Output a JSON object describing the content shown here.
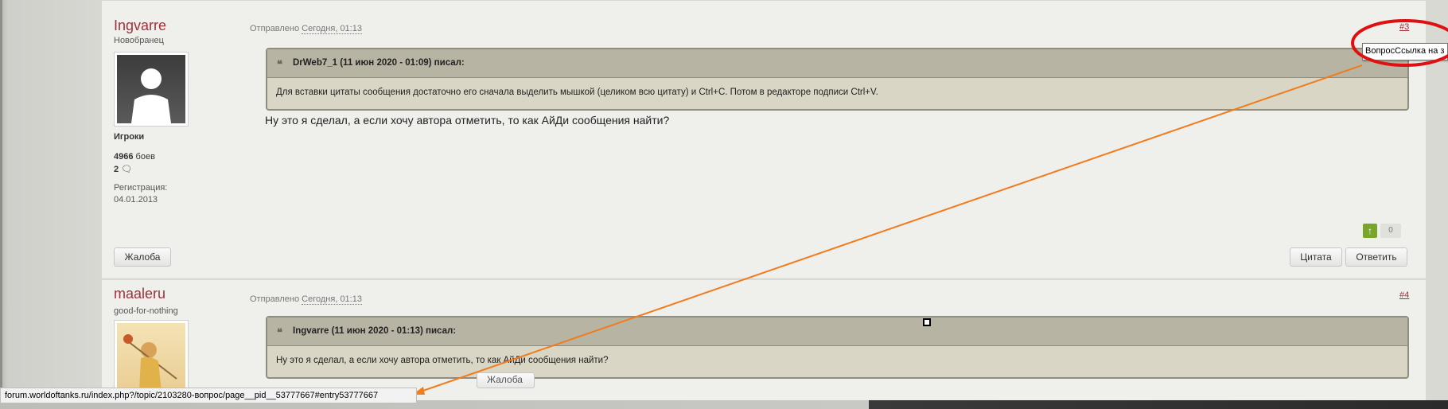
{
  "post1": {
    "author": "Ingvarre",
    "rank": "Новобранец",
    "group": "Игроки",
    "battles_count": "4966",
    "battles_label": "боев",
    "posts_count": "2",
    "reg_label": "Регистрация:",
    "reg_date": "04.01.2013",
    "posted_label": "Отправлено",
    "posted_date": "Сегодня, 01:13",
    "post_number": "#3",
    "quote_header": "DrWeb7_1 (11 июн 2020 - 01:09) писал:",
    "quote_body": "Для вставки цитаты сообщения достаточно его сначала выделить мышкой (целиком всю цитату) и Ctrl+C. Потом в редакторе подписи Ctrl+V.",
    "text": "Ну это я сделал, а если хочу автора отметить, то как АйДи сообщения найти?",
    "vote_count": "0",
    "report_label": "Жалоба",
    "quote_btn": "Цитата",
    "reply_btn": "Ответить"
  },
  "post2": {
    "author": "maaleru",
    "rank": "good-for-nothing",
    "posted_label": "Отправлено",
    "posted_date": "Сегодня, 01:13",
    "post_number": "#4",
    "quote_header": "Ingvarre (11 июн 2020 - 01:13) писал:",
    "quote_body": "Ну это я сделал, а если хочу автора отметить, то как АйДи сообщения найти?",
    "report_ghost": "Жалоба"
  },
  "tooltip": "ВопросСсылка на з",
  "status_url": "forum.worldoftanks.ru/index.php?/topic/2103280-вопрос/page__pid__53777667#entry53777667",
  "colors": {
    "author": "#a0303a",
    "annotation_arrow": "#f07c1e",
    "annotation_circle": "#e01010",
    "quote_bg": "#dad6c5",
    "quote_head": "#b8b4a3"
  },
  "icons": {
    "quote": "quote-icon",
    "vote_up": "arrow-up-icon",
    "posts": "speech-bubble-icon"
  }
}
